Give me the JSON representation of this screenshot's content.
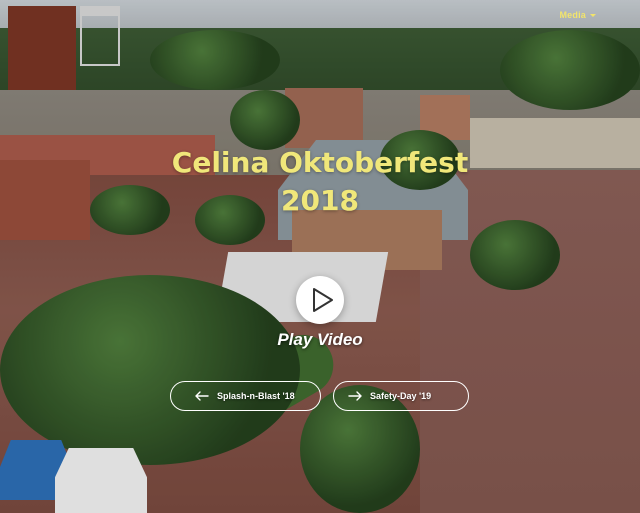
{
  "header": {
    "menu_label": "Media"
  },
  "hero": {
    "title_line1": "Celina Oktoberfest",
    "title_line2": "2018",
    "play_label": "Play Video"
  },
  "navigation": {
    "previous_label": "Splash-n-Blast '18",
    "next_label": "Safety-Day '19"
  },
  "icons": {
    "play": "play-icon",
    "arrow_left": "arrow-left-icon",
    "arrow_right": "arrow-right-icon",
    "caret": "chevron-down-icon"
  },
  "colors": {
    "title": "#f0e77a",
    "menu": "#f2e46b",
    "buttons": "#ffffff"
  }
}
